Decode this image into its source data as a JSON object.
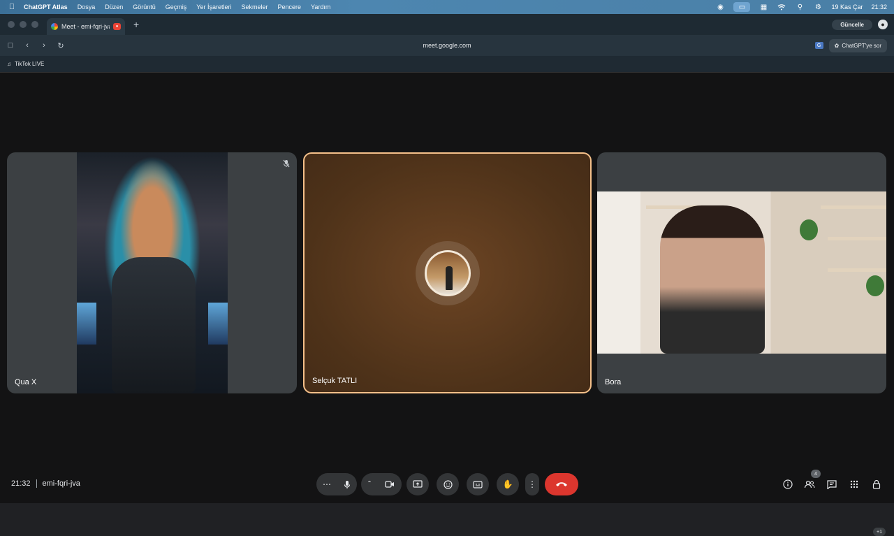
{
  "menubar": {
    "app_name": "ChatGPT Atlas",
    "menus": [
      "Dosya",
      "Düzen",
      "Görüntü",
      "Geçmiş",
      "Yer İşaretleri",
      "Sekmeler",
      "Pencere",
      "Yardım"
    ],
    "date": "19 Kas Çar",
    "time": "21:32"
  },
  "tab": {
    "title": "Meet - emi-fqri-jva"
  },
  "browser": {
    "update_label": "Güncelle",
    "url": "meet.google.com",
    "ask_label": "ChatGPT'ye sor"
  },
  "bookmarks": [
    {
      "label": "TikTok LIVE"
    }
  ],
  "participants": [
    {
      "name": "Qua X",
      "muted": true
    },
    {
      "name": "Selçuk TATLI",
      "speaking": true
    },
    {
      "name": "Bora"
    }
  ],
  "meeting": {
    "time": "21:32",
    "code": "emi-fqri-jva",
    "participant_count": "4",
    "extra_count": "+1"
  },
  "colors": {
    "end_call": "#dc362e",
    "speaking_border": "#f5c08a",
    "tile_bg": "#3c4043"
  }
}
